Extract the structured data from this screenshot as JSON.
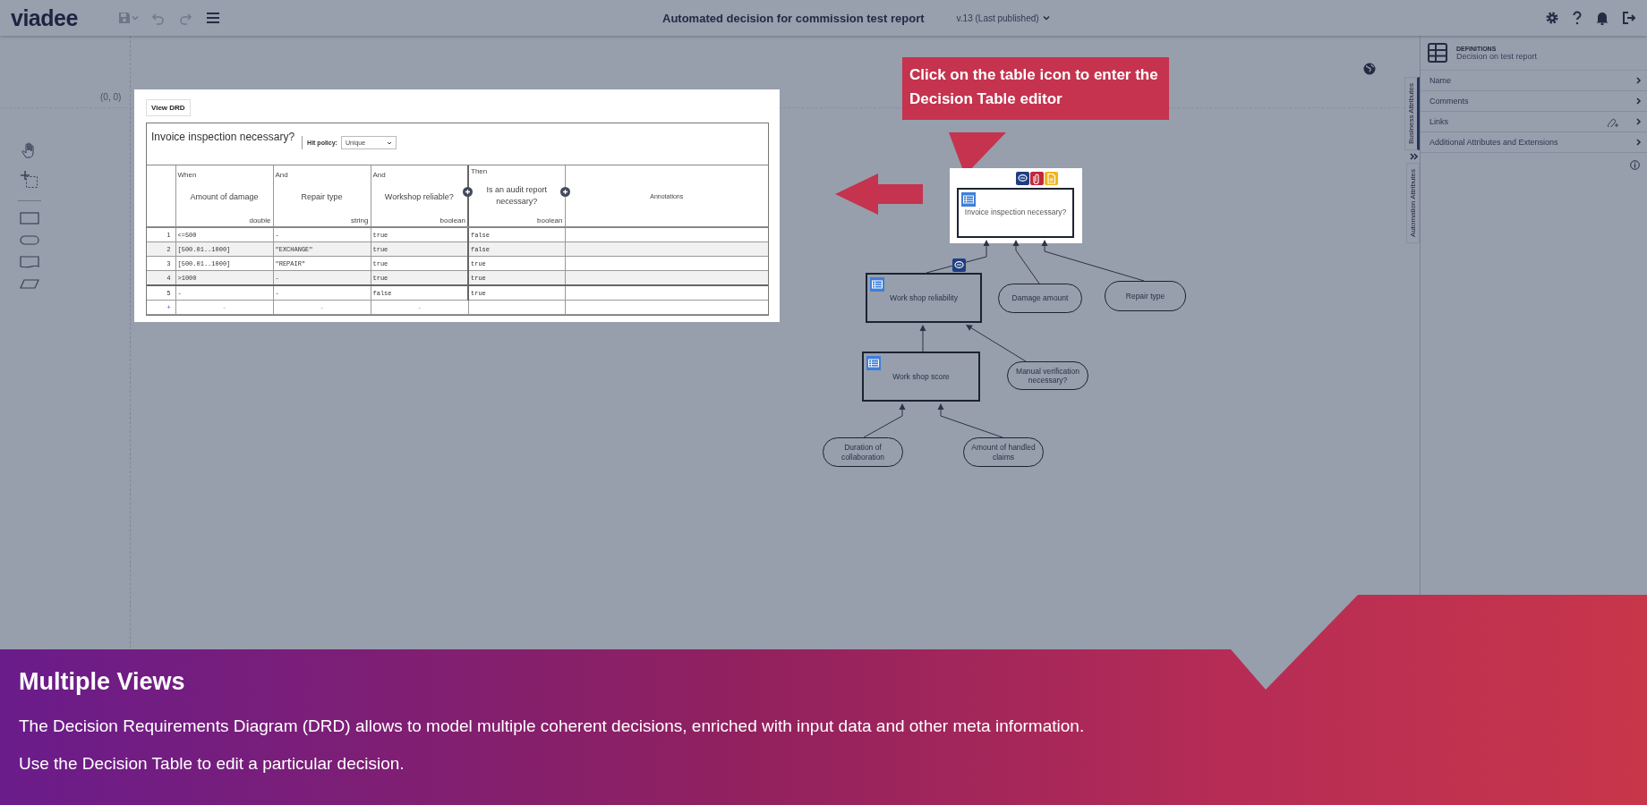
{
  "app_bar": {
    "logo": "viadee",
    "title": "Automated decision for commission test report",
    "version": "v.13 (Last published)"
  },
  "canvas": {
    "origin_label": "(0, 0)"
  },
  "decision_table": {
    "button": "View DRD",
    "title": "Invoice inspection necessary?",
    "hit_policy_label": "Hit policy:",
    "hit_policy": "Unique",
    "columns": [
      {
        "kind": "input",
        "prefix": "When",
        "label": "Amount of damage",
        "type": "double"
      },
      {
        "kind": "input",
        "prefix": "And",
        "label": "Repair type",
        "type": "string"
      },
      {
        "kind": "input",
        "prefix": "And",
        "label": "Workshop reliable?",
        "type": "boolean"
      },
      {
        "kind": "output",
        "prefix": "Then",
        "label": "Is an audit report necessary?",
        "type": "boolean"
      },
      {
        "kind": "annotation",
        "label": "Annotations"
      }
    ],
    "rows": [
      {
        "number": "1",
        "cells": [
          "<=500",
          "-",
          "true",
          "false"
        ]
      },
      {
        "number": "2",
        "cells": [
          "[500.01..1000]",
          "\"EXCHANGE\"",
          "true",
          "false"
        ]
      },
      {
        "number": "3",
        "cells": [
          "[500.01..1000]",
          "\"REPAIR\"",
          "true",
          "true"
        ]
      },
      {
        "number": "4",
        "cells": [
          ">1000",
          "-",
          "true",
          "true"
        ]
      },
      {
        "number": "5",
        "cells": [
          "-",
          "-",
          "false",
          "true"
        ]
      }
    ],
    "add_row": {
      "symbol": "+",
      "cells": [
        "-",
        "-",
        "-"
      ]
    }
  },
  "callout": {
    "text": "Click on the table icon to enter the Decision Table editor"
  },
  "drd": {
    "nodes": [
      {
        "kind": "decision",
        "label": "Invoice inspection necessary?",
        "selected": true,
        "badges": [
          {
            "kind": "comment"
          },
          {
            "kind": "attachment"
          },
          {
            "kind": "document"
          }
        ]
      },
      {
        "kind": "decision",
        "label": "Work shop reliability",
        "selected": false,
        "badges": [
          {
            "kind": "comment"
          }
        ]
      },
      {
        "kind": "input",
        "label": "Damage amount"
      },
      {
        "kind": "input",
        "label": "Repair type"
      },
      {
        "kind": "decision",
        "label": "Work shop score",
        "selected": false
      },
      {
        "kind": "input",
        "label": "Manual verification necessary?"
      },
      {
        "kind": "input",
        "label": "Duration of collaboration"
      },
      {
        "kind": "input",
        "label": "Amount of handled claims"
      }
    ]
  },
  "side_panel": {
    "vertical_tabs": [
      {
        "label": "Business Attributes",
        "selected": true
      },
      {
        "label": "Automation Attributes",
        "selected": false
      }
    ],
    "header": {
      "title": "DEFINITIONS",
      "subtitle": "Decision on test report"
    },
    "rows": [
      {
        "kind": "plain",
        "label": "Name"
      },
      {
        "kind": "plain",
        "label": "Comments"
      },
      {
        "kind": "links",
        "label": "Links"
      },
      {
        "kind": "plain",
        "label": "Additional Attributes and Extensions"
      }
    ]
  },
  "banner": {
    "title": "Multiple Views",
    "lines": [
      "The Decision Requirements Diagram (DRD) allows to model multiple coherent decisions, enriched with input data and other meta information.",
      "Use the Decision Table to edit a particular decision."
    ]
  }
}
